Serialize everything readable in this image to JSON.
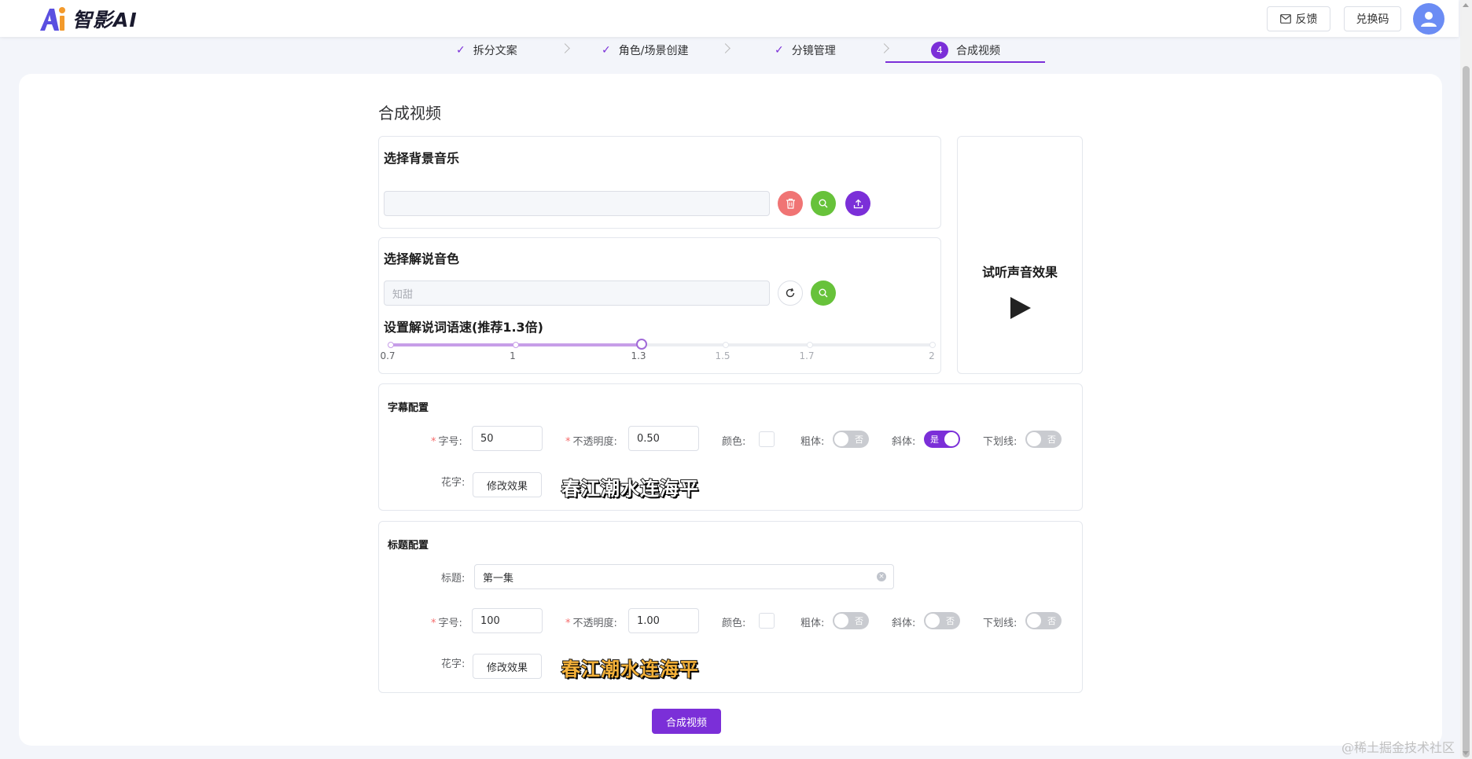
{
  "header": {
    "app_name": "智影AI",
    "feedback_label": "反馈",
    "redeem_label": "兑换码"
  },
  "steps": [
    {
      "label": "拆分文案",
      "state": "done"
    },
    {
      "label": "角色/场景创建",
      "state": "done"
    },
    {
      "label": "分镜管理",
      "state": "done"
    },
    {
      "label": "合成视频",
      "state": "active",
      "number": "4"
    }
  ],
  "page": {
    "title": "合成视频"
  },
  "music": {
    "title": "选择背景音乐",
    "value": ""
  },
  "voice": {
    "title": "选择解说音色",
    "placeholder": "知甜",
    "speed_title": "设置解说词语速(推荐1.3倍)",
    "speed_value": 1.3,
    "speed_marks": [
      "0.7",
      "1",
      "1.3",
      "1.5",
      "1.7",
      "2"
    ]
  },
  "preview": {
    "title": "试听声音效果"
  },
  "subtitle_config": {
    "title": "字幕配置",
    "font_size_label": "字号:",
    "font_size": "50",
    "opacity_label": "不透明度:",
    "opacity": "0.50",
    "color_label": "颜色:",
    "bold_label": "粗体:",
    "bold_state": "否",
    "italic_label": "斜体:",
    "italic_state": "是",
    "underline_label": "下划线:",
    "underline_state": "否",
    "fancy_label": "花字:",
    "modify_label": "修改效果",
    "sample_text": "春江潮水连海平"
  },
  "title_config": {
    "title": "标题配置",
    "title_label": "标题:",
    "title_value": "第一集",
    "font_size_label": "字号:",
    "font_size": "100",
    "opacity_label": "不透明度:",
    "opacity": "1.00",
    "color_label": "颜色:",
    "bold_label": "粗体:",
    "bold_state": "否",
    "italic_label": "斜体:",
    "italic_state": "否",
    "underline_label": "下划线:",
    "underline_state": "否",
    "fancy_label": "花字:",
    "modify_label": "修改效果",
    "sample_text": "春江潮水连海平"
  },
  "actions": {
    "compose_label": "合成视频"
  },
  "watermark": "@稀土掘金技术社区",
  "colors": {
    "accent": "#7b2fd8",
    "danger": "#f56c6c",
    "success": "#67c23a"
  }
}
